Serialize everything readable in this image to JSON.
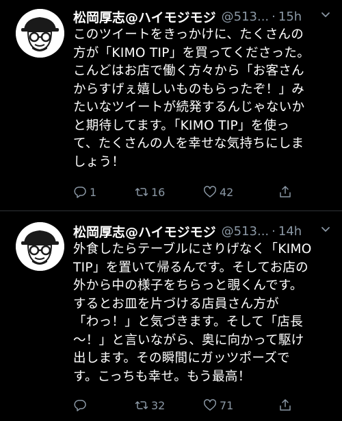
{
  "tweets": [
    {
      "author_name": "松岡厚志@ハイモジモジ",
      "handle": "@513...",
      "separator": "·",
      "time": "15h",
      "lines": [
        "このツイートをきっかけに、たくさんの",
        "方が「KIMO TIP」を買ってくださった。",
        "こんどはお店で働く方々から「お客さん",
        "からすげぇ嬉しいものもらったぞ！」み",
        "たいなツイートが続発するんじゃないか",
        "と期待してます。「KIMO TIP」を使っ",
        "て、たくさんの人を幸せな気持ちにしま",
        "しょう！"
      ],
      "reply_count": "1",
      "retweet_count": "16",
      "like_count": "42"
    },
    {
      "author_name": "松岡厚志@ハイモジモジ",
      "handle": "@513...",
      "separator": "·",
      "time": "14h",
      "lines": [
        "外食したらテーブルにさりげなく「KIMO",
        "TIP」を置いて帰るんです。そしてお店の",
        "外から中の様子をちらっと覗くんです。",
        "するとお皿を片づける店員さん方が",
        "「わっ！」と気づきます。そして「店長",
        "〜！」と言いながら、奥に向かって駆け",
        "出します。その瞬間にガッツポーズで",
        "す。こっちも幸せ。もう最高！"
      ],
      "reply_count": "",
      "retweet_count": "32",
      "like_count": "71"
    }
  ],
  "colors": {
    "background": "#000000",
    "text": "#ffffff",
    "muted": "#8b98a5",
    "divider": "#2f3336"
  },
  "icons": [
    "avatar-illustration",
    "chevron-down-icon",
    "reply-icon",
    "retweet-icon",
    "like-icon",
    "share-icon"
  ]
}
